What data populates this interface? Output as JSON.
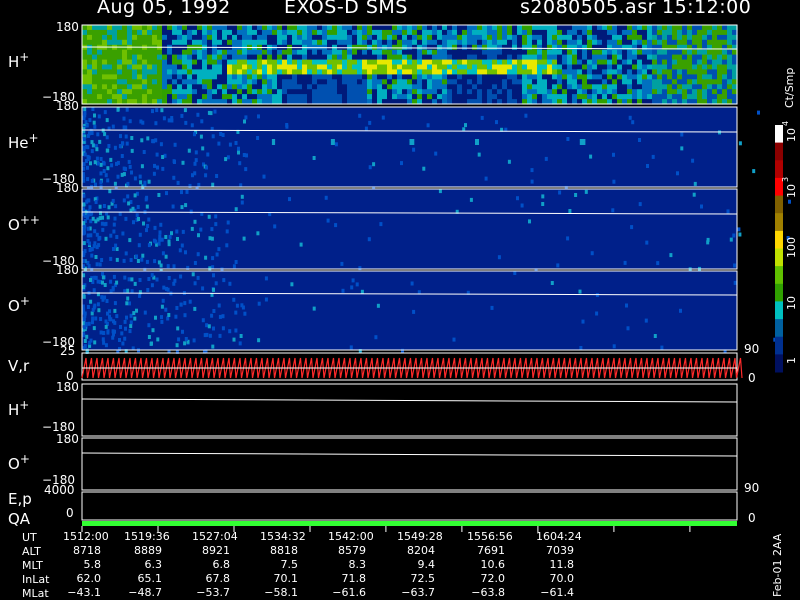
{
  "header": {
    "date": "Aug 05, 1992",
    "mission": "EXOS-D SMS",
    "file": "s2080505.asr",
    "time": "15:12:00"
  },
  "panels": [
    {
      "label": "H",
      "sup": "+",
      "ymax": "180",
      "ymin": "−180"
    },
    {
      "label": "He",
      "sup": "+",
      "ymax": "180",
      "ymin": "−180"
    },
    {
      "label": "O",
      "sup": "++",
      "ymax": "180",
      "ymin": "−180"
    },
    {
      "label": "O",
      "sup": "+",
      "ymax": "180",
      "ymin": "−180"
    }
  ],
  "vr_panel": {
    "label": "V,r",
    "left_top": "25",
    "left_bottom": "0",
    "right_top": "90",
    "right_bottom": "0"
  },
  "line_panels": [
    {
      "label": "H",
      "sup": "+",
      "ymax": "180",
      "ymin": "−180"
    },
    {
      "label": "O",
      "sup": "+",
      "ymax": "180",
      "ymin": "−180"
    }
  ],
  "ep_panel": {
    "label": "E,p",
    "left_top": "4000",
    "left_bottom": "0",
    "right_top": "90",
    "right_bottom": "0"
  },
  "qa_panel": {
    "label": "QA"
  },
  "colorbar": {
    "unit": "Ct/Smp",
    "labels": [
      "10",
      "10",
      "100",
      "10",
      "1"
    ],
    "sups": [
      "4",
      "3",
      "",
      "",
      ""
    ],
    "colors": [
      "#ffffff",
      "#8b0000",
      "#b00000",
      "#ff0000",
      "#806000",
      "#a08000",
      "#ffd700",
      "#c0e000",
      "#60c000",
      "#30a000",
      "#00c0c0",
      "#0060a0",
      "#003090",
      "#001060"
    ]
  },
  "ephemeris": {
    "labels": [
      "UT",
      "ALT",
      "MLT",
      "InLat",
      "MLat"
    ],
    "columns": [
      [
        "1512:00",
        "8718",
        "5.8",
        "62.0",
        "−43.1"
      ],
      [
        "1519:36",
        "8889",
        "6.3",
        "65.1",
        "−48.7"
      ],
      [
        "1527:04",
        "8921",
        "6.8",
        "67.8",
        "−53.7"
      ],
      [
        "1534:32",
        "8818",
        "7.5",
        "70.1",
        "−58.1"
      ],
      [
        "1542:00",
        "8579",
        "8.3",
        "71.8",
        "−61.6"
      ],
      [
        "1549:28",
        "8204",
        "9.4",
        "72.5",
        "−63.7"
      ],
      [
        "1556:56",
        "7691",
        "10.6",
        "72.0",
        "−63.8"
      ],
      [
        "1604:24",
        "7039",
        "11.8",
        "70.0",
        "−61.4"
      ]
    ]
  },
  "footer": {
    "stamp": "Feb-01 2AA"
  },
  "chart_data": {
    "type": "heatmap",
    "title": "Aug 05, 1992   EXOS-D SMS",
    "x_ticks": [
      "1512:00",
      "1519:36",
      "1527:04",
      "1534:32",
      "1542:00",
      "1549:28",
      "1556:56",
      "1604:24"
    ],
    "ylim": [
      -180,
      180
    ],
    "colorbar_unit": "Ct/Smp",
    "colorbar_range": [
      1,
      10000
    ],
    "colorbar_scale": "log",
    "panels": [
      "H+",
      "He+",
      "O++",
      "O+"
    ]
  }
}
